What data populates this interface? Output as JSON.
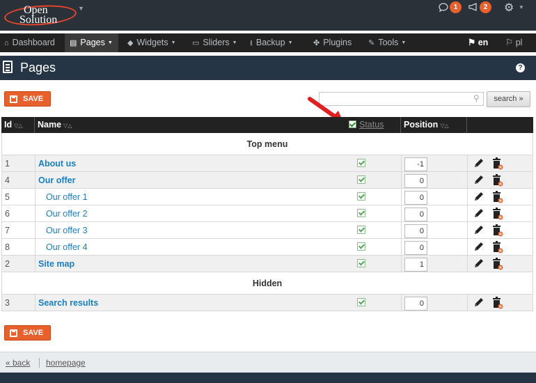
{
  "app": {
    "logo_line1": "Open",
    "logo_line2": "Solution",
    "notifications_count": "1",
    "messages_count": "2"
  },
  "nav": {
    "items": [
      {
        "label": "Dashboard",
        "icon": "home-icon"
      },
      {
        "label": "Pages",
        "icon": "page-icon"
      },
      {
        "label": "Widgets",
        "icon": "cube-icon"
      },
      {
        "label": "Sliders",
        "icon": "slider-icon"
      },
      {
        "label": "Backup",
        "icon": "download-icon"
      },
      {
        "label": "Plugins",
        "icon": "plugin-icon"
      },
      {
        "label": "Tools",
        "icon": "wrench-icon"
      }
    ],
    "languages": [
      {
        "label": "en",
        "active": true
      },
      {
        "label": "pl",
        "active": false
      }
    ]
  },
  "page": {
    "title": "Pages"
  },
  "toolbar": {
    "save_label": "SAVE",
    "search_placeholder": "",
    "search_value": "",
    "search_button": "search »"
  },
  "table": {
    "headers": {
      "id": "Id",
      "name": "Name",
      "status": "Status",
      "position": "Position"
    },
    "groups": [
      {
        "label": "Top menu",
        "rows": [
          {
            "id": "1",
            "name": "About us",
            "level": 0,
            "position": "-1"
          },
          {
            "id": "4",
            "name": "Our offer",
            "level": 0,
            "position": "0"
          },
          {
            "id": "5",
            "name": "Our offer 1",
            "level": 1,
            "position": "0"
          },
          {
            "id": "6",
            "name": "Our offer 2",
            "level": 1,
            "position": "0"
          },
          {
            "id": "7",
            "name": "Our offer 3",
            "level": 1,
            "position": "0"
          },
          {
            "id": "8",
            "name": "Our offer 4",
            "level": 1,
            "position": "0"
          },
          {
            "id": "2",
            "name": "Site map",
            "level": 0,
            "position": "1"
          }
        ]
      },
      {
        "label": "Hidden",
        "rows": [
          {
            "id": "3",
            "name": "Search results",
            "level": 0,
            "position": "0"
          }
        ]
      }
    ]
  },
  "footer": {
    "back_label": "« back",
    "home_label": "homepage"
  },
  "colors": {
    "accent": "#e8612c",
    "link": "#1a7fc1",
    "topbar": "#2a3138",
    "titlebar": "#253546"
  }
}
